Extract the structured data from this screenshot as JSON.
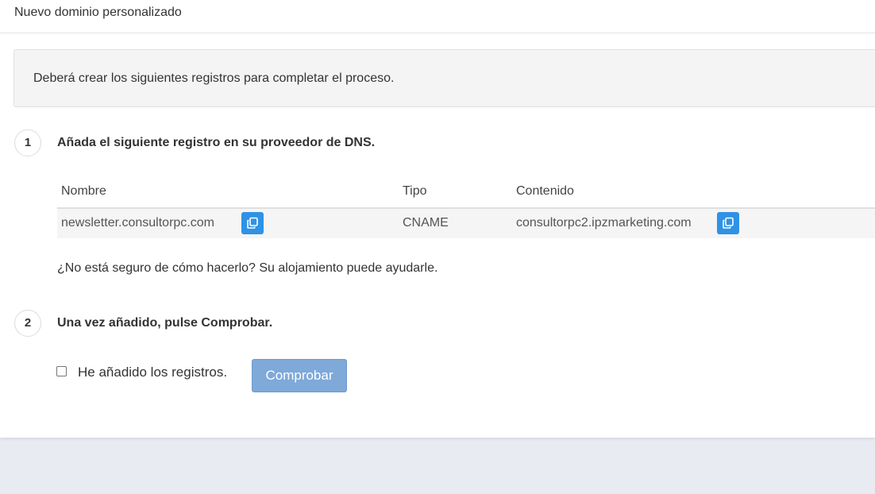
{
  "header": {
    "title": "Nuevo dominio personalizado"
  },
  "info": {
    "text": "Deberá crear los siguientes registros para completar el proceso."
  },
  "steps": [
    {
      "number": "1",
      "title": "Añada el siguiente registro en su proveedor de DNS."
    },
    {
      "number": "2",
      "title": "Una vez añadido, pulse Comprobar."
    }
  ],
  "table": {
    "headers": [
      "Nombre",
      "Tipo",
      "Contenido"
    ],
    "rows": [
      {
        "name": "newsletter.consultorpc.com",
        "type": "CNAME",
        "content": "consultorpc2.ipzmarketing.com"
      }
    ]
  },
  "help": {
    "text": "¿No está seguro de cómo hacerlo? Su alojamiento puede ayudarle."
  },
  "confirm": {
    "checkbox_label": "He añadido los registros.",
    "button_label": "Comprobar"
  },
  "icons": {
    "copy": "copy-icon"
  },
  "colors": {
    "copy_button": "#2f92e6",
    "verify_button_disabled": "#7ea9d8",
    "page_background": "#e9ebf2"
  }
}
